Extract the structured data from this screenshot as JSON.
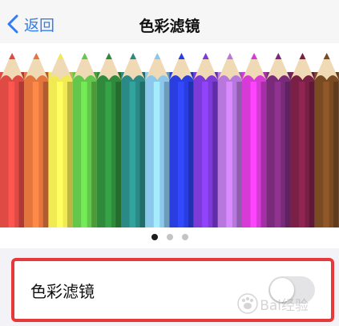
{
  "navbar": {
    "back_label": "返回",
    "title": "色彩滤镜"
  },
  "preview": {
    "pencil_colors": [
      "#e04a44",
      "#e4753c",
      "#f2ea52",
      "#62c74a",
      "#2f8a3c",
      "#2b8a86",
      "#8cc8ec",
      "#2a3ee0",
      "#7c3ad6",
      "#b877dc",
      "#d83ad8",
      "#7a2a7a",
      "#7a1f45",
      "#7a4a22"
    ],
    "pages": 3,
    "active_page": 1
  },
  "filter_row": {
    "label": "色彩滤镜",
    "toggle_on": false
  },
  "watermark": {
    "text": "Bai经验"
  }
}
